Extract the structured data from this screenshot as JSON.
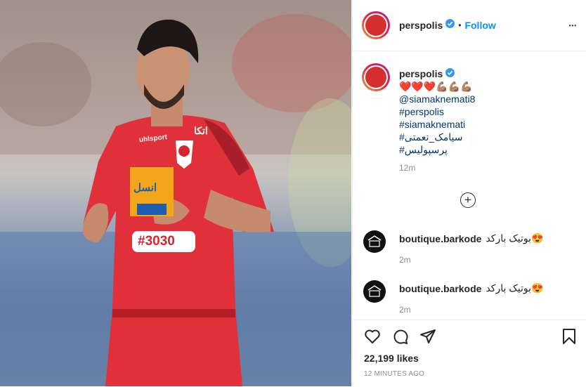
{
  "post_image": {
    "alt": "",
    "jersey": {
      "sponsor": "انسل",
      "number_text": "#3030",
      "brand": "uhlsport",
      "club_name": "اتکا"
    }
  },
  "header": {
    "username": "perspolis",
    "separator": "•",
    "follow_label": "Follow",
    "more_label": "•••"
  },
  "caption": {
    "username": "perspolis",
    "emoji_line": "❤️❤️❤️💪🏽💪🏽💪🏽",
    "mention": "@siamaknemati8",
    "hashtags": [
      "#perspolis",
      "#siamaknemati",
      "#سیامک_نعمتی",
      "#پرسپولیس"
    ],
    "time": "12m"
  },
  "load_more": "+",
  "comments": [
    {
      "username": "boutique.barkode",
      "text": "بوتیک بارکد😍",
      "time": "2m"
    },
    {
      "username": "boutique.barkode",
      "text": "بوتیک بارکد😍",
      "time": "2m"
    }
  ],
  "likes": "22,199 likes",
  "timestamp": "12 MINUTES AGO"
}
